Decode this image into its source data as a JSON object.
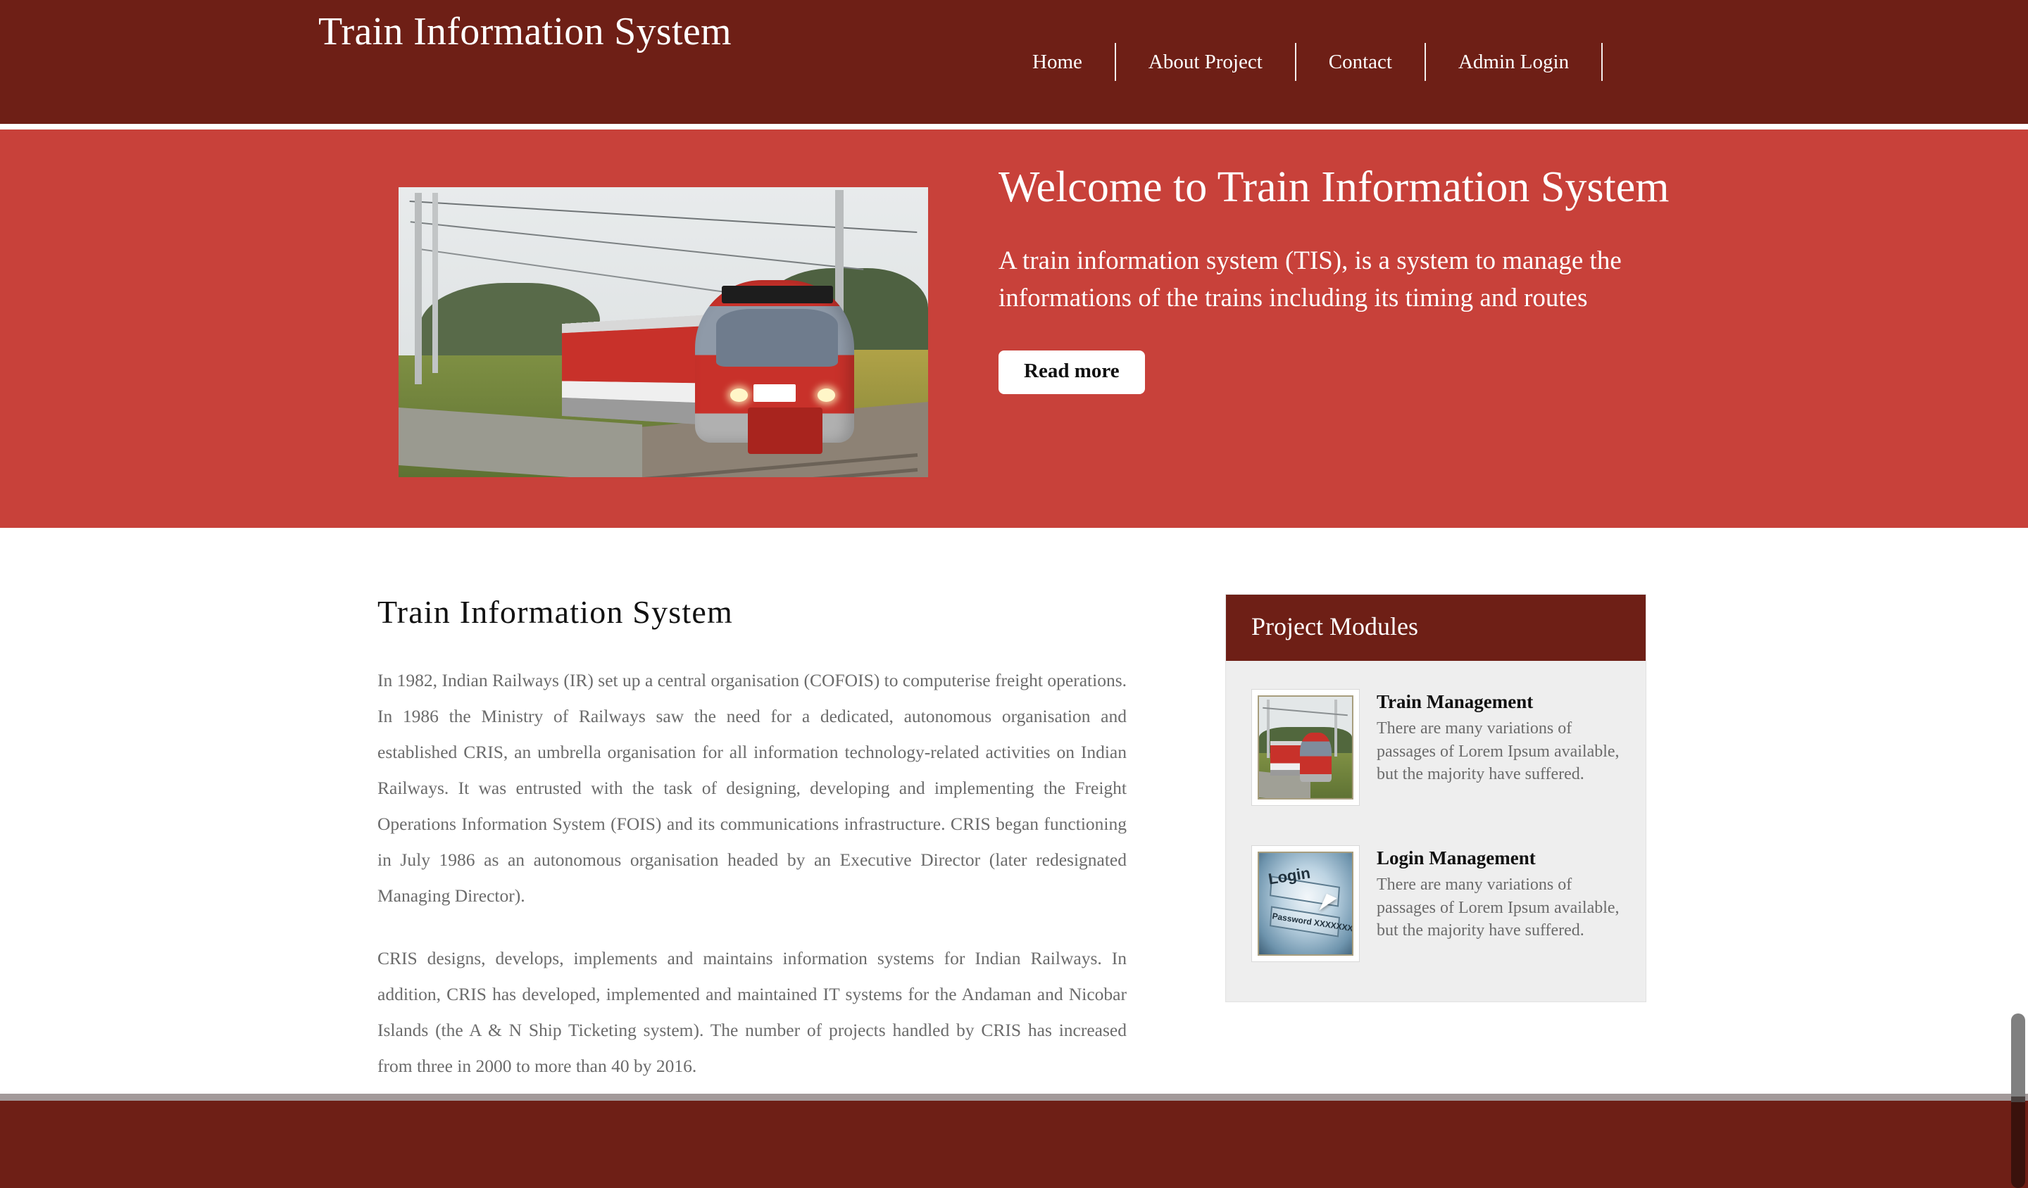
{
  "header": {
    "brand_title": "Train Information System",
    "nav": [
      {
        "label": "Home"
      },
      {
        "label": "About Project"
      },
      {
        "label": "Contact"
      },
      {
        "label": "Admin Login"
      }
    ]
  },
  "hero": {
    "title": "Welcome to Train Information System",
    "subtitle": "A train information system (TIS), is a system to manage the informations of the trains including its timing and routes",
    "button_label": "Read more",
    "image_alt": "red DB regional train RE9 Rostock Hbf on track with overhead catenary",
    "background_color": "#C8413A"
  },
  "content": {
    "article": {
      "heading": "Train Information System",
      "paragraphs": [
        "In 1982, Indian Railways (IR) set up a central organisation (COFOIS) to computerise freight operations. In 1986 the Ministry of Railways saw the need for a dedicated, autonomous organisation and established CRIS, an umbrella organisation for all information technology-related activities on Indian Railways. It was entrusted with the task of designing, developing and implementing the Freight Operations Information System (FOIS) and its communications infrastructure. CRIS began functioning in July 1986 as an autonomous organisation headed by an Executive Director (later redesignated Managing Director).",
        "CRIS designs, develops, implements and maintains information systems for Indian Railways. In addition, CRIS has developed, implemented and maintained IT systems for the Andaman and Nicobar Islands (the A & N Ship Ticketing system). The number of projects handled by CRIS has increased from three in 2000 to more than 40 by 2016."
      ]
    },
    "sidebar": {
      "panel_title": "Project Modules",
      "modules": [
        {
          "title": "Train Management",
          "description": "There are many variations of passages of Lorem Ipsum available, but the majority have suffered.",
          "thumb_alt": "red train on railway track"
        },
        {
          "title": "Login Management",
          "description": "There are many variations of passages of Lorem Ipsum available, but the majority have suffered.",
          "thumb_alt": "login form illustration with password field and mouse cursor"
        }
      ]
    }
  },
  "login_thumb_text": {
    "login_label": "Login",
    "password_label": "Password XXXXXXXX"
  },
  "theme": {
    "header_color": "#6E1F16",
    "hero_color": "#C8413A",
    "panel_bg": "#EEEEEE",
    "footer_color": "#6E1F16",
    "footer_rule_color": "#A39A9A",
    "body_text_color": "#6B6B6B"
  }
}
